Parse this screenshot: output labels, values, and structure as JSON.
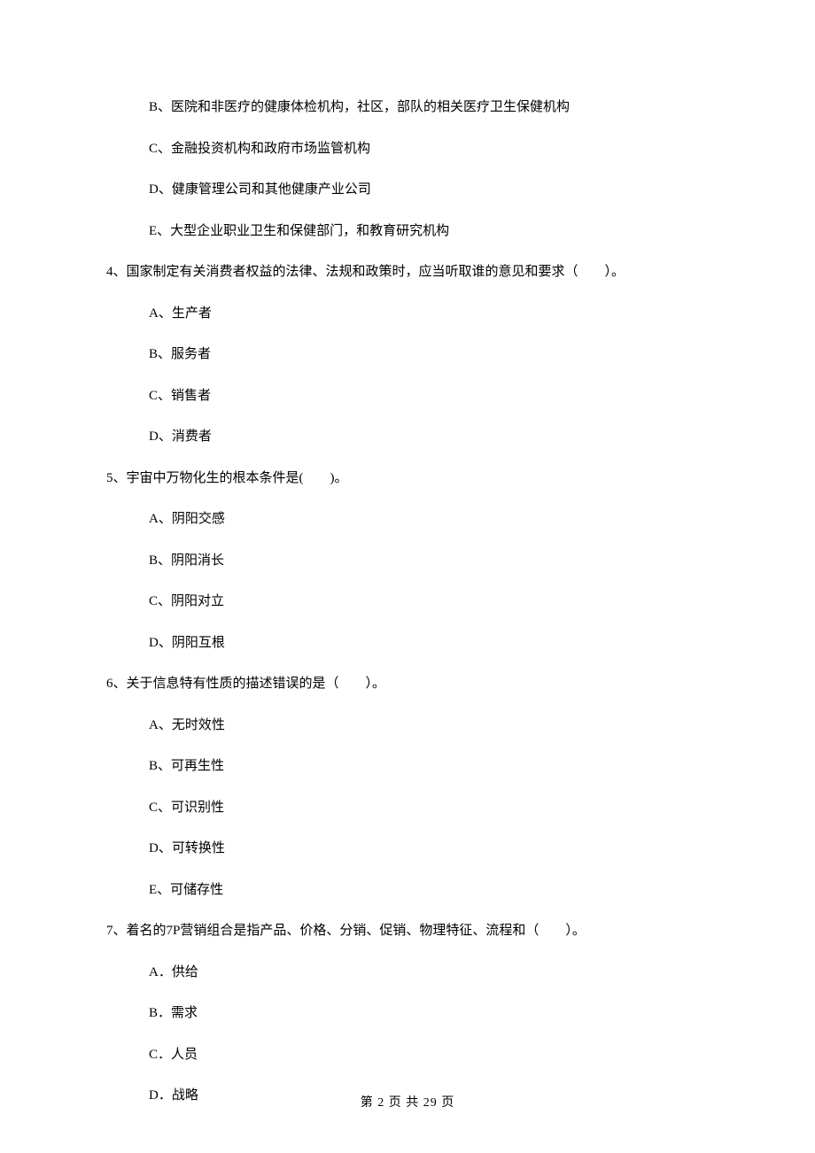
{
  "options_top": [
    "B、医院和非医疗的健康体检机构，社区，部队的相关医疗卫生保健机构",
    "C、金融投资机构和政府市场监管机构",
    "D、健康管理公司和其他健康产业公司",
    "E、大型企业职业卫生和保健部门，和教育研究机构"
  ],
  "q4": {
    "stem": "4、国家制定有关消费者权益的法律、法规和政策时，应当听取谁的意见和要求（　　）。",
    "opts": [
      "A、生产者",
      "B、服务者",
      "C、销售者",
      "D、消费者"
    ]
  },
  "q5": {
    "stem": "5、宇宙中万物化生的根本条件是(　　)。",
    "opts": [
      "A、阴阳交感",
      "B、阴阳消长",
      "C、阴阳对立",
      "D、阴阳互根"
    ]
  },
  "q6": {
    "stem": "6、关于信息特有性质的描述错误的是（　　）。",
    "opts": [
      "A、无时效性",
      "B、可再生性",
      "C、可识别性",
      "D、可转换性",
      "E、可储存性"
    ]
  },
  "q7": {
    "stem": "7、着名的7P营销组合是指产品、价格、分销、促销、物理特征、流程和（　　）。",
    "opts": [
      "A．供给",
      "B．需求",
      "C．人员",
      "D．战略"
    ]
  },
  "footer": "第 2 页 共 29 页"
}
